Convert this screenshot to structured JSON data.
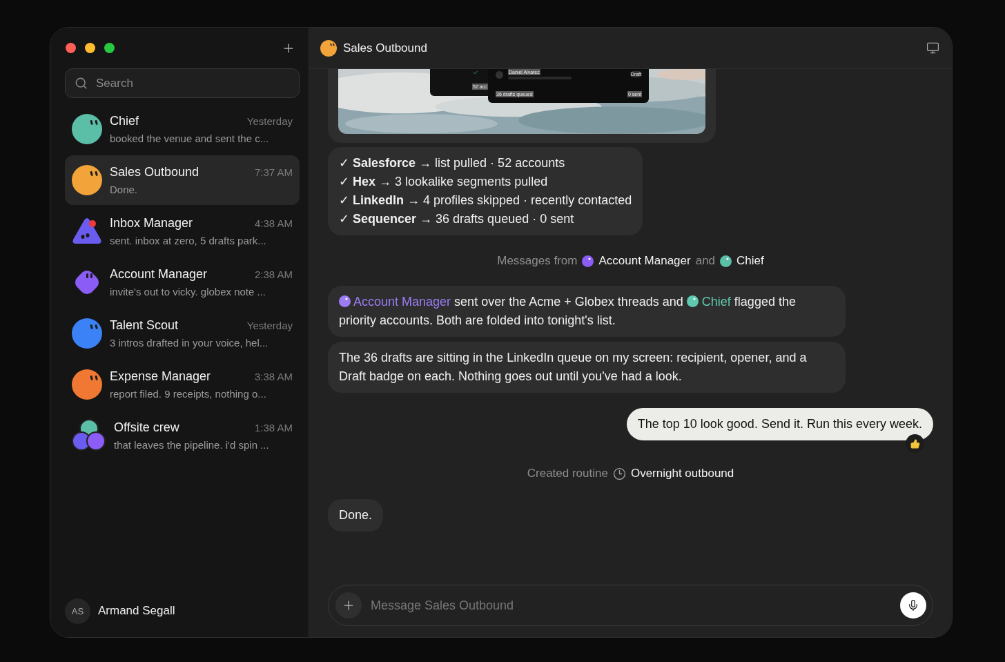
{
  "sidebar": {
    "search": {
      "placeholder": "Search"
    },
    "chats": [
      {
        "name": "Chief",
        "time": "Yesterday",
        "preview": "booked the venue and sent the c...",
        "kind": "circle",
        "color": "#5bbfa8",
        "selected": false
      },
      {
        "name": "Sales Outbound",
        "time": "7:37 AM",
        "preview": "Done.",
        "kind": "circle",
        "color": "#f2a33a",
        "selected": true
      },
      {
        "name": "Inbox Manager",
        "time": "4:38 AM",
        "preview": "sent. inbox at zero, 5 drafts park...",
        "kind": "triangle",
        "color": "#6b5cf0",
        "selected": false
      },
      {
        "name": "Account Manager",
        "time": "2:38 AM",
        "preview": "invite's out to vicky. globex note ...",
        "kind": "rounded",
        "color": "#8b5cf6",
        "selected": false
      },
      {
        "name": "Talent Scout",
        "time": "Yesterday",
        "preview": "3 intros drafted in your voice, hel...",
        "kind": "circle",
        "color": "#3b82f6",
        "selected": false
      },
      {
        "name": "Expense Manager",
        "time": "3:38 AM",
        "preview": "report filed. 9 receipts, nothing o...",
        "kind": "circle",
        "color": "#f07832",
        "selected": false
      },
      {
        "name": "Offsite crew",
        "time": "1:38 AM",
        "preview": "that leaves the pipeline. i'd spin ...",
        "kind": "group",
        "selected": false
      }
    ],
    "user": {
      "initials": "AS",
      "name": "Armand Segall"
    }
  },
  "conversation": {
    "title": "Sales Outbound",
    "color": "#f2a33a",
    "screenshot": {
      "count": "52 acc",
      "recipient": "Daniel Alvarez",
      "badge": "Draft",
      "queued": "36 drafts queued",
      "sent": "0 sent"
    },
    "steps": [
      "✓ **Salesforce** → list pulled · 52 accounts",
      "✓ **Hex** → 3 lookalike segments pulled",
      "✓ **LinkedIn** → 4 profiles skipped · recently contacted",
      "✓ **Sequencer** → 36 drafts queued · 0 sent"
    ],
    "participants_note": {
      "label": "Messages from",
      "joiner": "and",
      "participants": [
        {
          "name": "Account Manager",
          "color": "#8b5cf6"
        },
        {
          "name": "Chief",
          "color": "#5bbfa8"
        }
      ]
    },
    "messages": [
      {
        "kind": "agent",
        "segments": [
          {
            "kind": "mention",
            "text": "Account Manager",
            "color": "#9b7cf4"
          },
          {
            "kind": "text",
            "text": " sent over the Acme + Globex threads and "
          },
          {
            "kind": "mention",
            "text": "Chief",
            "color": "#5fc9b0"
          },
          {
            "kind": "text",
            "text": " flagged the priority accounts. Both are folded into tonight's list."
          }
        ]
      },
      {
        "kind": "agent",
        "segments": [
          {
            "kind": "text",
            "text": "The 36 drafts are sitting in the LinkedIn queue on my screen: recipient, opener, and a Draft badge on each. Nothing goes out until you've had a look."
          }
        ]
      },
      {
        "kind": "user",
        "reaction": true,
        "segments": [
          {
            "kind": "text",
            "text": "The top 10 look good. Send it. Run this every week."
          }
        ]
      },
      {
        "kind": "event",
        "label": "Created routine",
        "value": "Overnight outbound"
      },
      {
        "kind": "agent",
        "segments": [
          {
            "kind": "text",
            "text": "Done."
          }
        ]
      }
    ],
    "composer": {
      "placeholder": "Message Sales Outbound"
    }
  }
}
